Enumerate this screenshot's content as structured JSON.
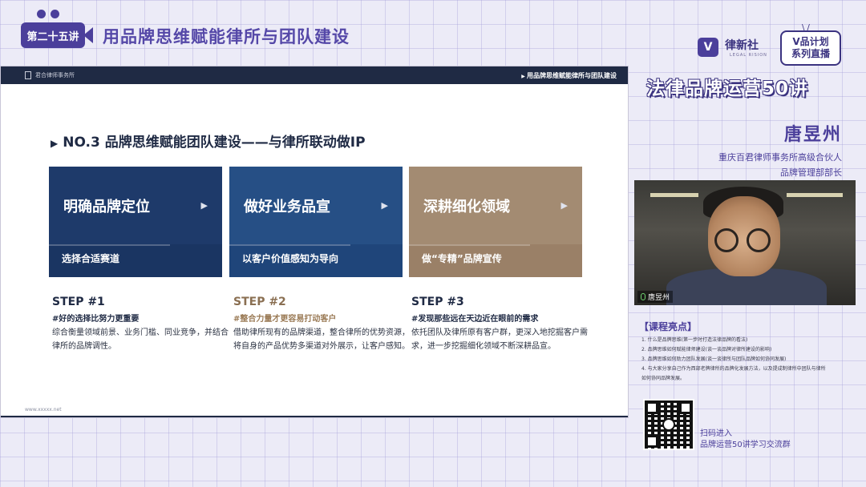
{
  "banner": {
    "lecture_label": "第二十五讲",
    "lecture_title": "用品牌思维赋能律所与团队建设"
  },
  "slide": {
    "header_logo": "君合律师事务所",
    "header_title": "用品牌思维赋能律所与团队建设",
    "heading": "NO.3 品牌思维赋能团队建设——与律所联动做IP",
    "cards": [
      {
        "title": "明确品牌定位",
        "subtitle": "选择合适赛道"
      },
      {
        "title": "做好业务品宣",
        "subtitle": "以客户价值感知为导向"
      },
      {
        "title": "深耕细化领域",
        "subtitle": "做“专精”品牌宣传"
      }
    ],
    "steps": [
      {
        "title": "STEP #1",
        "subtitle": "#好的选择比努力更重要",
        "body": "综合衡量领域前景、业务门槛、同业竞争，并结合律所的品牌调性。"
      },
      {
        "title": "STEP #2",
        "subtitle": "#整合力量才更容易打动客户",
        "body": "借助律所现有的品牌渠道，整合律所的优势资源，将自身的产品优势多渠道对外展示，让客户感知。"
      },
      {
        "title": "STEP #3",
        "subtitle": "#发现那些远在天边近在眼前的需求",
        "body": "依托团队及律所原有客户群，更深入地挖掘客户需求，进一步挖掘细化领域不断深耕品宣。"
      }
    ],
    "footer": "www.xxxxx.net"
  },
  "brand": {
    "logo_glyph": "V",
    "name": "律新社",
    "sub": "LEGAL RISION",
    "tv_line1": "V品计划",
    "tv_line2": "系列直播",
    "series_title": "法律品牌运营50讲"
  },
  "speaker": {
    "name": "唐昱州",
    "org": "重庆百君律师事务所高级合伙人",
    "role": "品牌管理部部长",
    "video_label": "唐昱州"
  },
  "highlights": {
    "title": "【课程亮点】",
    "items": [
      "1. 什么是品牌思维(第一步时打造法律品牌的看法)",
      "2. 品牌思维如何赋能律师建设(谈一谈品牌对律所建设的影响)",
      "3. 品牌思维如何助力团队发展(谈一谈律所与团队品牌如何协同发展)",
      "4. 与大家分享自己作为西部老牌律所的品牌化发展方法，以及提成制律所中团队与律所",
      "   如何协同品牌发展。"
    ]
  },
  "qr": {
    "line1": "扫码进入",
    "line2": "品牌运营50讲学习交流群"
  }
}
